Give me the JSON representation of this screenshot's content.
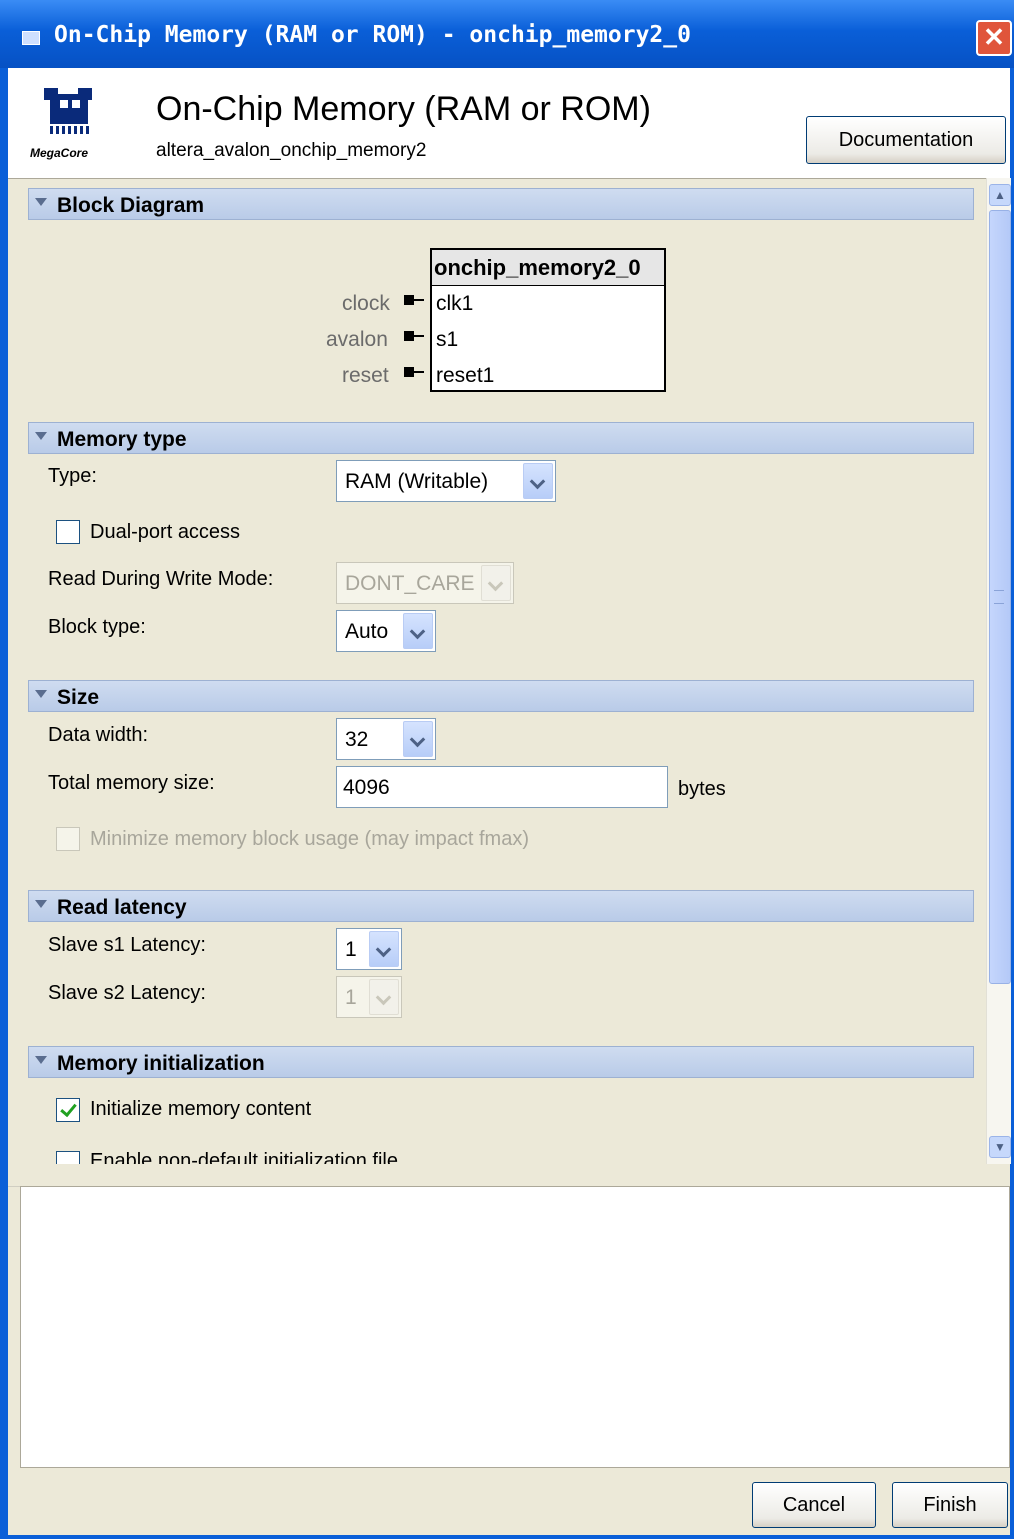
{
  "window": {
    "title": "On-Chip Memory (RAM or ROM) - onchip_memory2_0",
    "close_symbol": "✕"
  },
  "header": {
    "title": "On-Chip Memory (RAM or ROM)",
    "subtitle": "altera_avalon_onchip_memory2",
    "logo_caption": "MegaCore",
    "documentation_button": "Documentation"
  },
  "block_diagram": {
    "section_label": "Block Diagram",
    "component_name": "onchip_memory2_0",
    "ports": [
      {
        "interface": "clock",
        "name": "clk1"
      },
      {
        "interface": "avalon",
        "name": "s1"
      },
      {
        "interface": "reset",
        "name": "reset1"
      }
    ]
  },
  "memory_type": {
    "section_label": "Memory type",
    "type_label": "Type:",
    "type_value": "RAM (Writable)",
    "dual_port_label": "Dual-port access",
    "dual_port_checked": false,
    "rdw_label": "Read During Write Mode:",
    "rdw_value": "DONT_CARE",
    "block_type_label": "Block type:",
    "block_type_value": "Auto"
  },
  "size": {
    "section_label": "Size",
    "data_width_label": "Data width:",
    "data_width_value": "32",
    "total_size_label": "Total memory size:",
    "total_size_value": "4096",
    "total_size_unit": "bytes",
    "minimize_label": "Minimize memory block usage (may impact fmax)",
    "minimize_checked": false
  },
  "read_latency": {
    "section_label": "Read latency",
    "s1_label": "Slave s1 Latency:",
    "s1_value": "1",
    "s2_label": "Slave s2 Latency:",
    "s2_value": "1"
  },
  "memory_init": {
    "section_label": "Memory initialization",
    "init_content_label": "Initialize memory content",
    "init_content_checked": true,
    "nondefault_label": "Enable non-default initialization file",
    "nondefault_checked": false
  },
  "footer": {
    "cancel_button": "Cancel",
    "finish_button": "Finish"
  },
  "colors": {
    "titlebar": "#0a5fd8",
    "section_header": "#c3d3ee",
    "dialog_background": "#ece9d8"
  }
}
